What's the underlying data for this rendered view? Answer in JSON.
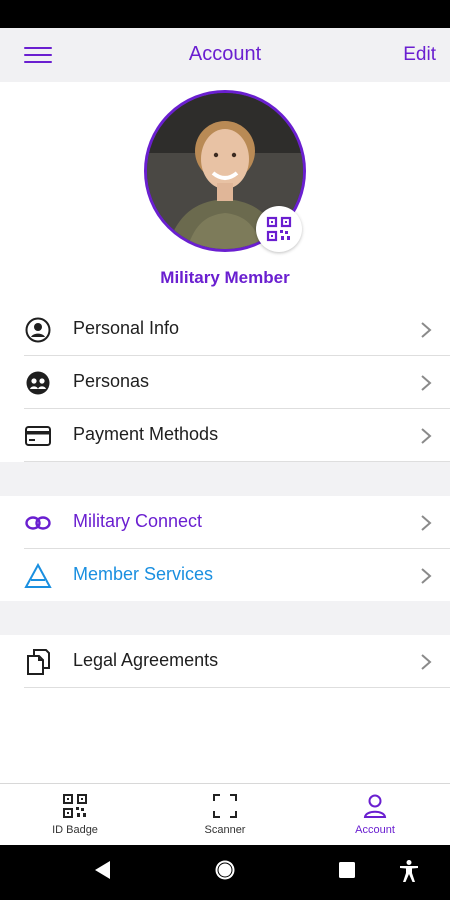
{
  "header": {
    "title": "Account",
    "edit_label": "Edit"
  },
  "profile": {
    "name": "Military Member"
  },
  "sections": [
    {
      "items": [
        {
          "label": "Personal Info",
          "icon": "person-circle-icon",
          "color": "#1f1f1f"
        },
        {
          "label": "Personas",
          "icon": "personas-icon",
          "color": "#1f1f1f"
        },
        {
          "label": "Payment Methods",
          "icon": "credit-card-icon",
          "color": "#1f1f1f"
        }
      ]
    },
    {
      "items": [
        {
          "label": "Military Connect",
          "icon": "link-icon",
          "color": "#6a1fd0"
        },
        {
          "label": "Member Services",
          "icon": "triangle-logo-icon",
          "color": "#1a8fe0"
        }
      ]
    },
    {
      "items": [
        {
          "label": "Legal Agreements",
          "icon": "documents-icon",
          "color": "#1f1f1f"
        }
      ]
    }
  ],
  "bottom_nav": [
    {
      "label": "ID Badge",
      "icon": "qr-code-icon",
      "active": false
    },
    {
      "label": "Scanner",
      "icon": "scanner-icon",
      "active": false
    },
    {
      "label": "Account",
      "icon": "account-icon",
      "active": true
    }
  ],
  "colors": {
    "accent": "#6a1fd0",
    "member_services": "#1a8fe0"
  }
}
